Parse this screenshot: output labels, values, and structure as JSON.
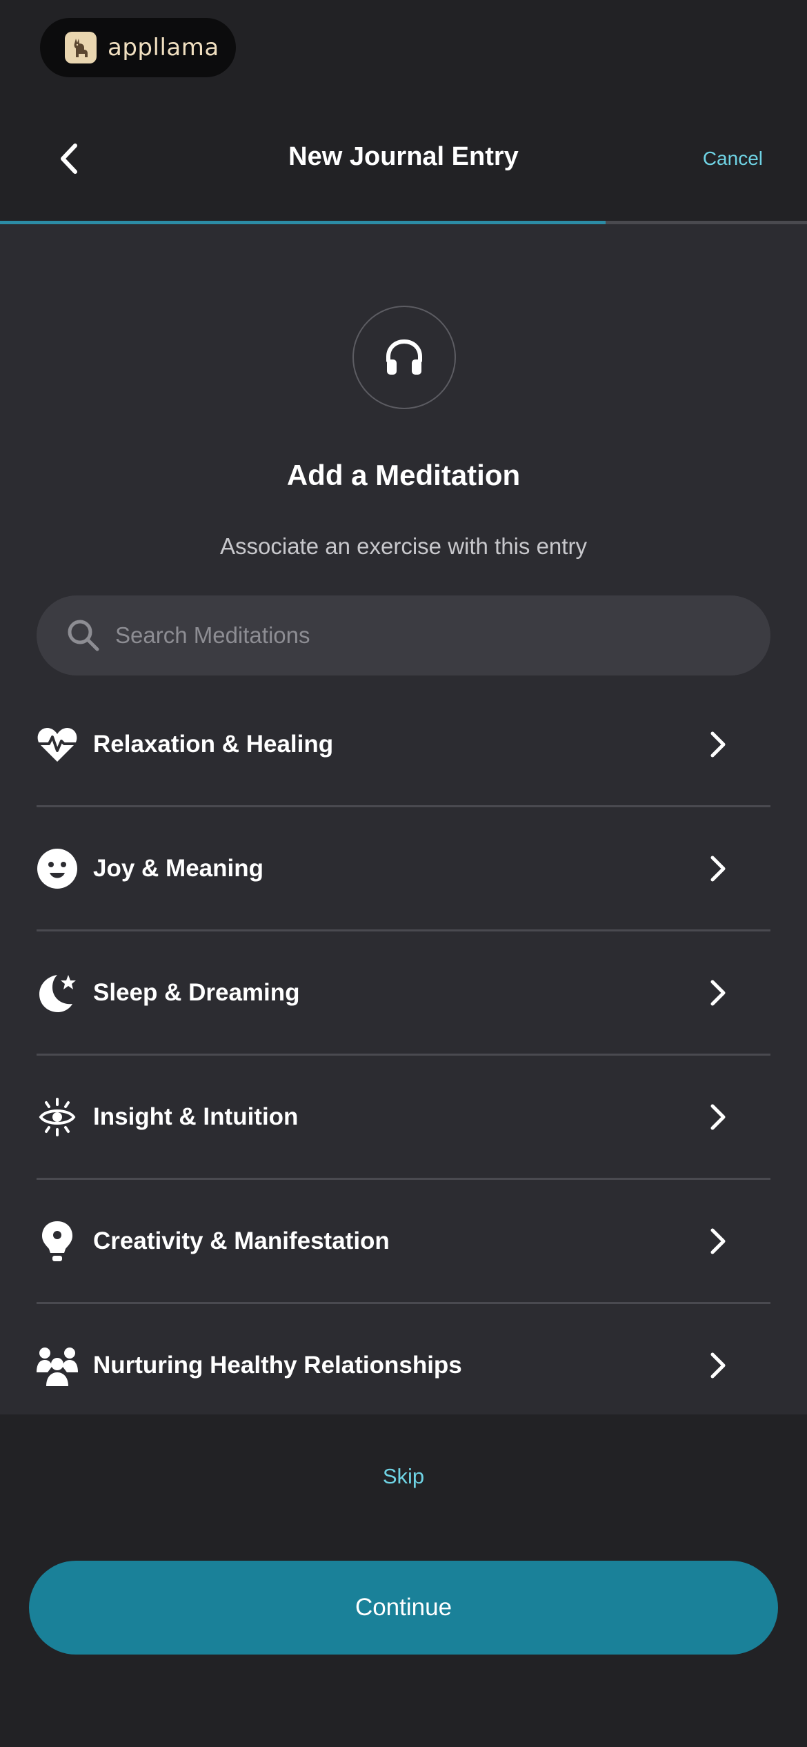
{
  "brand": {
    "name": "appllama",
    "logo_icon": "llama-icon"
  },
  "nav": {
    "title": "New Journal Entry",
    "cancel_label": "Cancel",
    "back_icon": "chevron-left-icon"
  },
  "progress": {
    "fraction": 0.75,
    "color": "#2c8ca5"
  },
  "main": {
    "icon": "headphones-icon",
    "heading": "Add a Meditation",
    "subheading": "Associate an exercise with this entry"
  },
  "search": {
    "placeholder": "Search Meditations",
    "value": ""
  },
  "categories": [
    {
      "label": "Relaxation & Healing",
      "icon": "heart-pulse-icon"
    },
    {
      "label": "Joy & Meaning",
      "icon": "smile-icon"
    },
    {
      "label": "Sleep & Dreaming",
      "icon": "moon-star-icon"
    },
    {
      "label": "Insight & Intuition",
      "icon": "eye-icon"
    },
    {
      "label": "Creativity & Manifestation",
      "icon": "lightbulb-icon"
    },
    {
      "label": "Nurturing Healthy Relationships",
      "icon": "people-icon"
    }
  ],
  "footer": {
    "skip_label": "Skip",
    "continue_label": "Continue"
  },
  "colors": {
    "accent": "#1a8199",
    "link": "#6fd3e4",
    "background": "#2c2c31"
  }
}
